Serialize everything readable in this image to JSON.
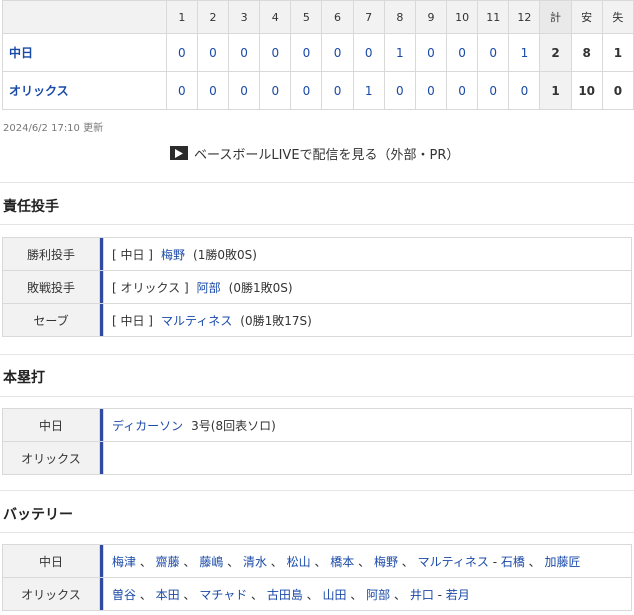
{
  "scoreboard": {
    "innings": [
      "1",
      "2",
      "3",
      "4",
      "5",
      "6",
      "7",
      "8",
      "9",
      "10",
      "11",
      "12"
    ],
    "totals_headers": [
      "計",
      "安",
      "失"
    ],
    "teams": [
      {
        "name": "中日",
        "innings": [
          "0",
          "0",
          "0",
          "0",
          "0",
          "0",
          "0",
          "1",
          "0",
          "0",
          "0",
          "1"
        ],
        "totals": [
          "2",
          "8",
          "1"
        ]
      },
      {
        "name": "オリックス",
        "innings": [
          "0",
          "0",
          "0",
          "0",
          "0",
          "0",
          "1",
          "0",
          "0",
          "0",
          "0",
          "0"
        ],
        "totals": [
          "1",
          "10",
          "0"
        ]
      }
    ]
  },
  "updated": "2024/6/2 17:10 更新",
  "live_link": "ベースボールLIVEで配信を見る（外部・PR）",
  "pitchers": {
    "title": "責任投手",
    "rows": [
      {
        "label": "勝利投手",
        "team": "[ 中日 ]",
        "player": "梅野",
        "stats": "(1勝0敗0S)"
      },
      {
        "label": "敗戦投手",
        "team": "[ オリックス ]",
        "player": "阿部",
        "stats": "(0勝1敗0S)"
      },
      {
        "label": "セーブ",
        "team": "[ 中日 ]",
        "player": "マルティネス",
        "stats": "(0勝1敗17S)"
      }
    ]
  },
  "homeruns": {
    "title": "本塁打",
    "rows": [
      {
        "label": "中日",
        "player": "ディカーソン",
        "detail": "3号(8回表ソロ)"
      },
      {
        "label": "オリックス",
        "player": "",
        "detail": ""
      }
    ]
  },
  "battery": {
    "title": "バッテリー",
    "rows": [
      {
        "label": "中日",
        "pitchers": [
          "梅津",
          "齋藤",
          "藤嶋",
          "清水",
          "松山",
          "橋本",
          "梅野",
          "マルティネス"
        ],
        "dash": " - ",
        "catchers": [
          "石橋",
          "加藤匠"
        ]
      },
      {
        "label": "オリックス",
        "pitchers": [
          "曽谷",
          "本田",
          "マチャド",
          "古田島",
          "山田",
          "阿部",
          "井口"
        ],
        "dash": " - ",
        "catchers": [
          "若月"
        ]
      }
    ]
  },
  "colors": {
    "link": "#1a4aa8",
    "bar": "#2f4aa0",
    "header_bg": "#f2f2f2"
  }
}
